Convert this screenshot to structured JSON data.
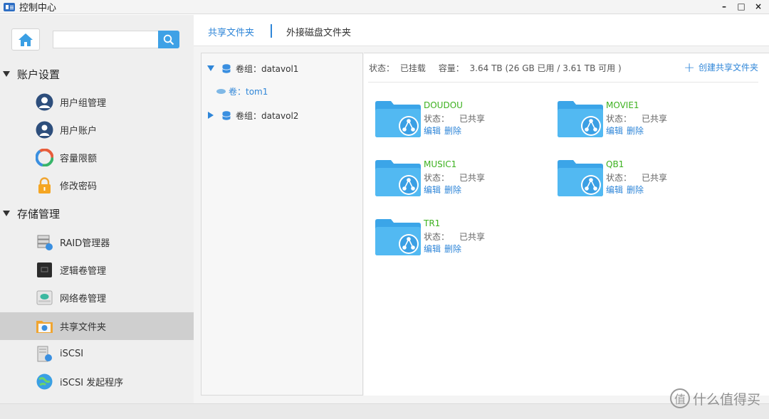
{
  "window": {
    "title": "控制中心",
    "minimize": "–",
    "maximize": "□",
    "close": "×"
  },
  "sidebar": {
    "search": {
      "placeholder": ""
    },
    "groups": [
      {
        "label": "账户设置",
        "items": [
          "用户组管理",
          "用户账户",
          "容量限额",
          "修改密码"
        ]
      },
      {
        "label": "存储管理",
        "items": [
          "RAID管理器",
          "逻辑卷管理",
          "网络卷管理",
          "共享文件夹",
          "iSCSI",
          "iSCSI 发起程序"
        ]
      }
    ],
    "active_item": "共享文件夹"
  },
  "tabs": {
    "shared": "共享文件夹",
    "external": "外接磁盘文件夹"
  },
  "tree": {
    "vol1": "卷组：datavol1",
    "vol1_child": "卷：tom1",
    "vol2": "卷组：datavol2"
  },
  "status": {
    "state_label": "状态：",
    "state_value": "已挂载",
    "capacity_label": "容量：",
    "capacity_value": "3.64 TB (26 GB 已用 / 3.61 TB 可用 )",
    "create_label": "创建共享文件夹"
  },
  "folders": [
    {
      "name": "DOUDOU",
      "status_label": "状态：",
      "status": "已共享",
      "edit": "编辑",
      "delete": "删除"
    },
    {
      "name": "MOVIE1",
      "status_label": "状态：",
      "status": "已共享",
      "edit": "编辑",
      "delete": "删除"
    },
    {
      "name": "MUSIC1",
      "status_label": "状态：",
      "status": "已共享",
      "edit": "编辑",
      "delete": "删除"
    },
    {
      "name": "QB1",
      "status_label": "状态：",
      "status": "已共享",
      "edit": "编辑",
      "delete": "删除"
    },
    {
      "name": "TR1",
      "status_label": "状态：",
      "status": "已共享",
      "edit": "编辑",
      "delete": "删除"
    }
  ],
  "watermark": {
    "text": "什么值得买",
    "icon": "值"
  },
  "colors": {
    "accent": "#2f86d8",
    "folder_name": "#3db11f",
    "sidebar_bg": "#efefef",
    "active_item_bg": "#cfcfcf"
  },
  "icons": [
    "app-icon",
    "home-icon",
    "search-icon",
    "user-group-icon",
    "user-icon",
    "quota-icon",
    "lock-icon",
    "raid-icon",
    "logical-volume-icon",
    "network-volume-icon",
    "shared-folder-icon",
    "iscsi-icon",
    "iscsi-initiator-icon",
    "database-icon",
    "folder-share-icon",
    "plus-icon"
  ]
}
